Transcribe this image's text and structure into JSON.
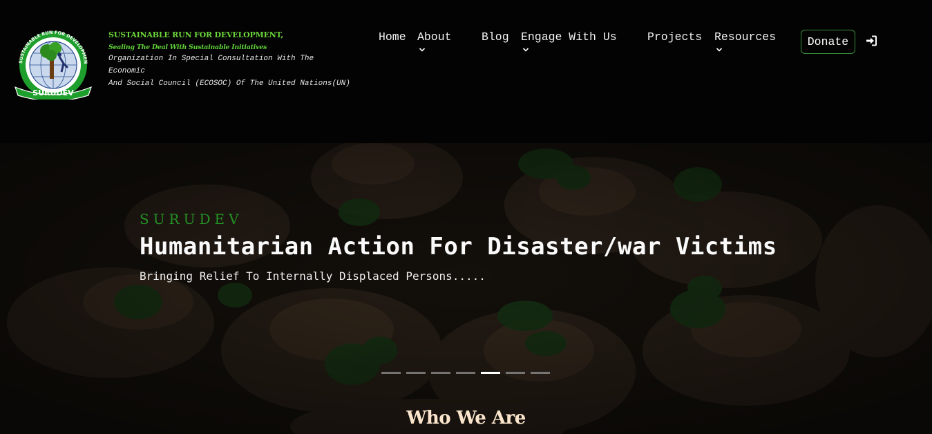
{
  "header": {
    "org_name": "SUSTAINABLE RUN FOR DEVELOPMENT,",
    "tagline": "Sealing The Deal With Sustainable Initiatives",
    "status_line1": "Organization In Special Consultation With The",
    "status_line2": "Economic",
    "status_line3": "And Social Council (ECOSOC) Of The United Nations(UN)",
    "logo_ring_text": "SUSTAINABLE RUN FOR DEVELOPMENT",
    "logo_banner_text": "SURUDEV"
  },
  "nav": {
    "items": [
      {
        "label": "Home",
        "dropdown": false
      },
      {
        "label": "About",
        "dropdown": true
      },
      {
        "label": "Blog",
        "dropdown": false
      },
      {
        "label": "Engage With Us",
        "dropdown": true
      },
      {
        "label": "Projects",
        "dropdown": false
      },
      {
        "label": "Resources",
        "dropdown": true
      }
    ],
    "donate_label": "Donate",
    "login_icon": "sign-in-icon"
  },
  "hero": {
    "brand": "SURUDEV",
    "title": "Humanitarian Action For Disaster/war Victims",
    "subtitle": "Bringing Relief To Internally Displaced Persons.....",
    "slide_count": 7,
    "active_slide": 5
  },
  "sections": {
    "who_we_are": "Who We Are"
  },
  "colors": {
    "brand_green": "#6cd63a",
    "hero_brand": "#249124",
    "section_title": "#fbe6cd",
    "donate_border": "#3a8f3a"
  }
}
